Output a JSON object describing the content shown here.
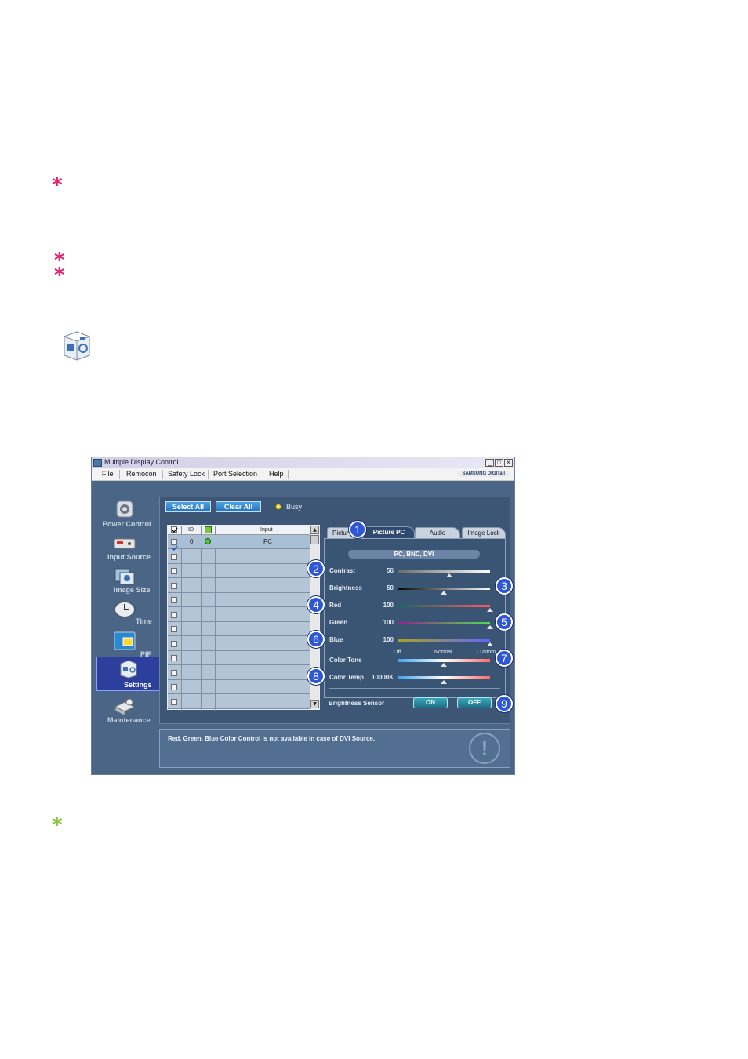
{
  "window": {
    "title": "Multiple Display Control",
    "brand": "SAMSUNG DIGITall",
    "controls": {
      "minimize": "_",
      "maximize": "□",
      "close": "×"
    }
  },
  "menu": [
    "File",
    "Remocon",
    "Safety Lock",
    "Port Selection",
    "Help"
  ],
  "sidebar": [
    {
      "label": "Power Control",
      "icon": "power-control-icon"
    },
    {
      "label": "Input Source",
      "icon": "input-source-icon"
    },
    {
      "label": "Image Size",
      "icon": "image-size-icon"
    },
    {
      "label": "Time",
      "icon": "clock-icon"
    },
    {
      "label": "PIP",
      "icon": "pip-icon"
    },
    {
      "label": "Settings",
      "icon": "settings-cube-icon",
      "selected": true
    },
    {
      "label": "Maintenance",
      "icon": "maintenance-icon"
    }
  ],
  "toolbar": {
    "select_all": "Select All",
    "clear_all": "Clear All",
    "busy": "Busy"
  },
  "grid": {
    "columns": [
      "ID",
      "Input"
    ],
    "rows": [
      {
        "checked": true,
        "id": "0",
        "status": "on",
        "input": "PC"
      },
      {
        "checked": false,
        "id": "",
        "input": ""
      },
      {
        "checked": false,
        "id": "",
        "input": ""
      },
      {
        "checked": false,
        "id": "",
        "input": ""
      },
      {
        "checked": false,
        "id": "",
        "input": ""
      },
      {
        "checked": false,
        "id": "",
        "input": ""
      },
      {
        "checked": false,
        "id": "",
        "input": ""
      },
      {
        "checked": false,
        "id": "",
        "input": ""
      },
      {
        "checked": false,
        "id": "",
        "input": ""
      },
      {
        "checked": false,
        "id": "",
        "input": ""
      },
      {
        "checked": false,
        "id": "",
        "input": ""
      },
      {
        "checked": false,
        "id": "",
        "input": ""
      }
    ]
  },
  "tabs": [
    "Pictur",
    "Picture PC",
    "Audio",
    "Image Lock"
  ],
  "active_tab": "Picture PC",
  "panel": {
    "section": "PC, BNC, DVI",
    "sliders": [
      {
        "label": "Contrast",
        "value": "56",
        "fraction": 0.56
      },
      {
        "label": "Brightness",
        "value": "50",
        "fraction": 0.5
      },
      {
        "label": "Red",
        "value": "100",
        "fraction": 1.0
      },
      {
        "label": "Green",
        "value": "100",
        "fraction": 1.0
      },
      {
        "label": "Blue",
        "value": "100",
        "fraction": 1.0
      }
    ],
    "color_tone": {
      "label": "Color Tone",
      "options": [
        "Off",
        "Normal",
        "Custom"
      ],
      "selected": "Normal"
    },
    "color_temp": {
      "label": "Color Temp",
      "value": "10000K",
      "fraction": 0.5
    },
    "brightness_sensor": {
      "label": "Brightness Sensor",
      "on": "ON",
      "off": "OFF"
    }
  },
  "callouts": [
    "1",
    "2",
    "3",
    "4",
    "5",
    "6",
    "7",
    "8",
    "9"
  ],
  "status": {
    "message": "Red, Green, Blue Color Control is not available in case of DVI Source.",
    "icon": "!"
  },
  "asterisks": [
    "*",
    "*",
    "*",
    "*"
  ],
  "colors": {
    "asterisk_pink": "#e8206c",
    "asterisk_green": "#8cc63f",
    "window_bg": "#4a6585"
  }
}
